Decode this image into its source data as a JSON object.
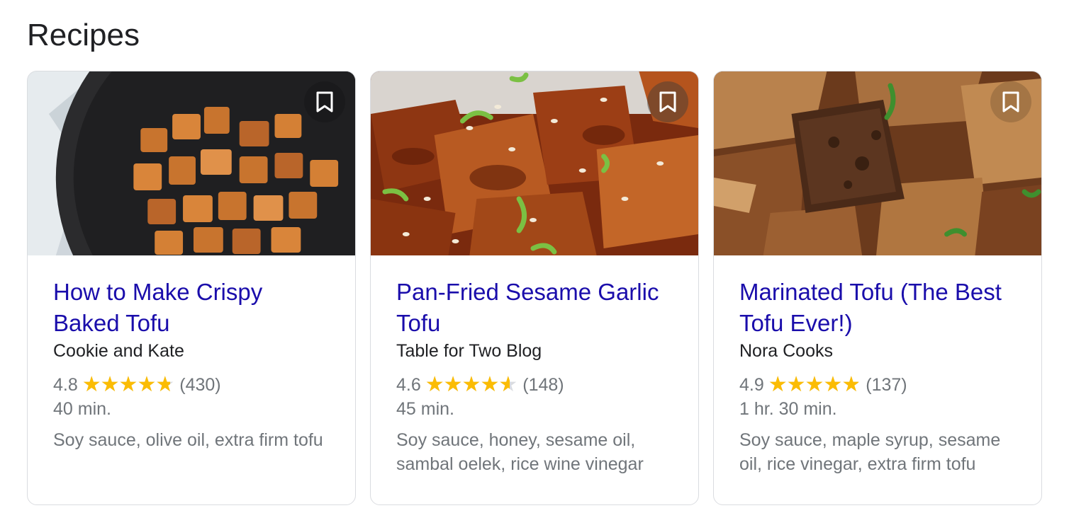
{
  "section": {
    "title": "Recipes"
  },
  "cards": [
    {
      "title": "How to Make Crispy Baked Tofu",
      "source": "Cookie and Kate",
      "rating": "4.8",
      "rating_fraction": 0.96,
      "reviews": "(430)",
      "time": "40 min.",
      "ingredients": "Soy sauce, olive oil, extra firm tofu",
      "save_icon": "bookmark-icon"
    },
    {
      "title": "Pan-Fried Sesame Garlic Tofu",
      "source": "Table for Two Blog",
      "rating": "4.6",
      "rating_fraction": 0.92,
      "reviews": "(148)",
      "time": "45 min.",
      "ingredients": "Soy sauce, honey, sesame oil, sambal oelek, rice wine vinegar",
      "save_icon": "bookmark-icon"
    },
    {
      "title": "Marinated Tofu (The Best Tofu Ever!)",
      "source": "Nora Cooks",
      "rating": "4.9",
      "rating_fraction": 0.98,
      "reviews": "(137)",
      "time": "1 hr. 30 min.",
      "ingredients": "Soy sauce, maple syrup, sesame oil, rice vinegar, extra firm tofu",
      "save_icon": "bookmark-icon"
    }
  ],
  "colors": {
    "link": "#1a0dab",
    "star": "#fbbc04",
    "muted": "#70757a"
  }
}
